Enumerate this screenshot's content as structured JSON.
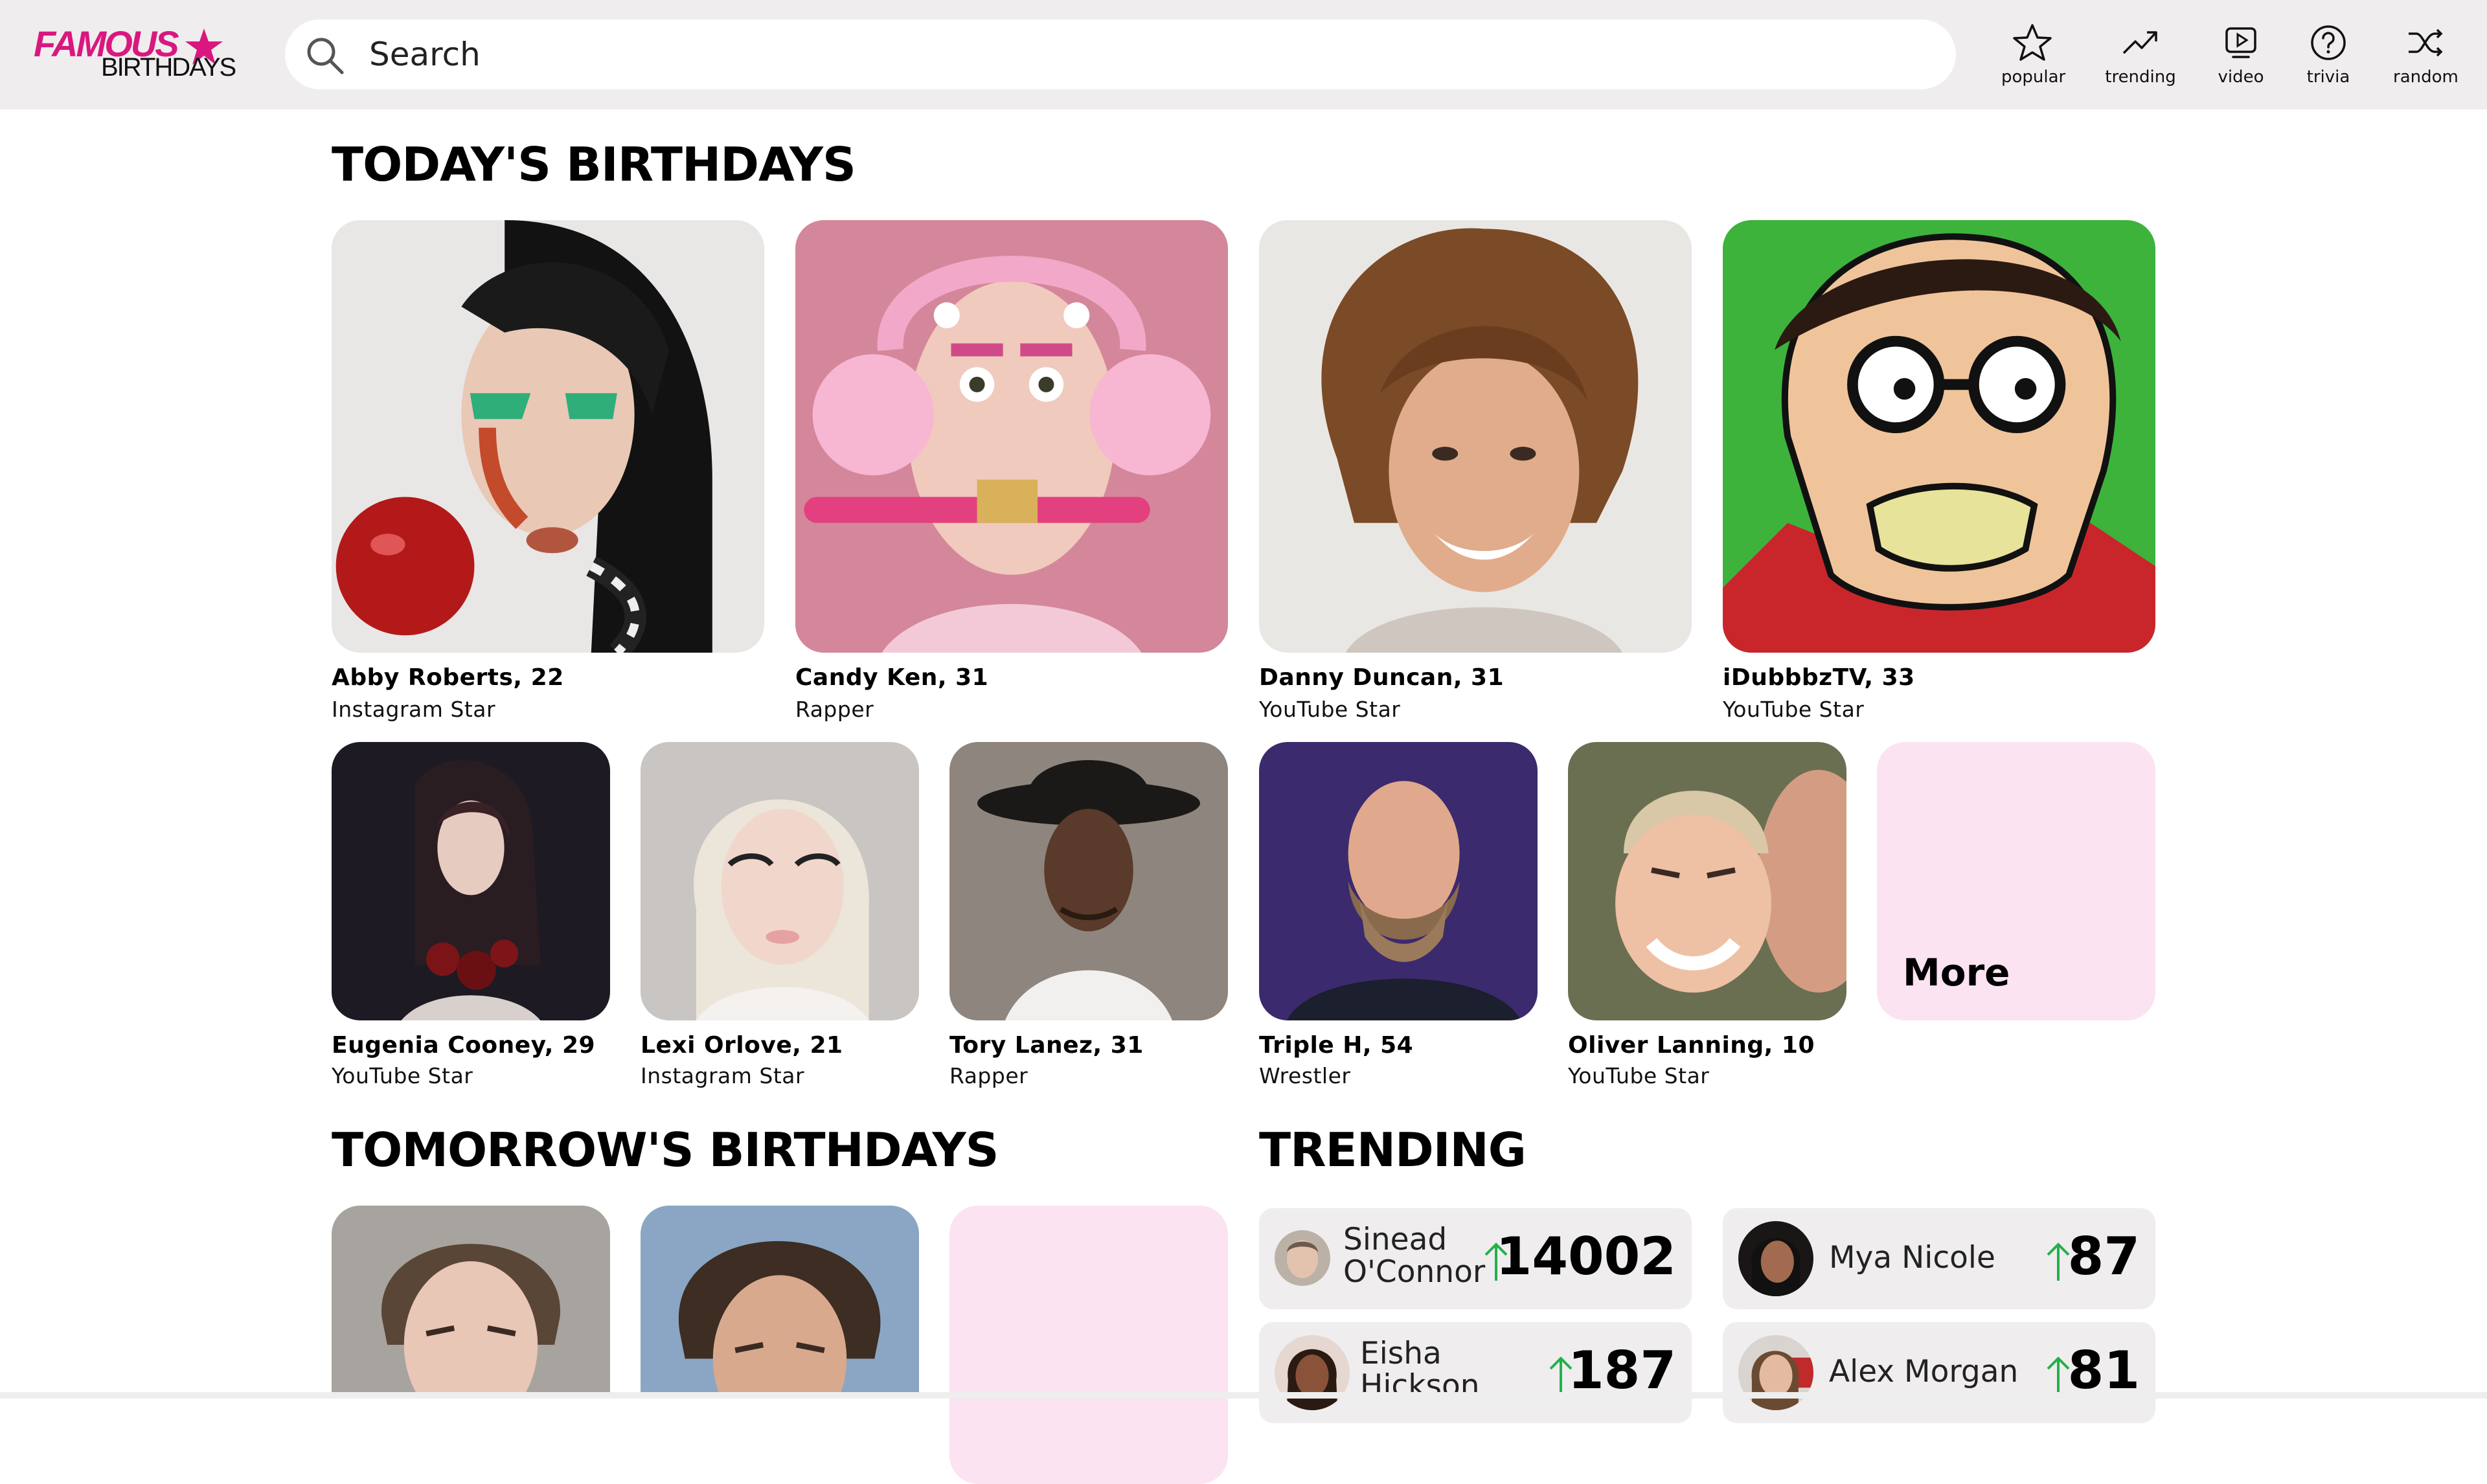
{
  "header": {
    "logo_top": "FAMOUS",
    "logo_bottom": "BIRTHDAYS",
    "search_placeholder": "Search",
    "nav": [
      {
        "label": "popular",
        "icon": "star-icon"
      },
      {
        "label": "trending",
        "icon": "trending-icon"
      },
      {
        "label": "video",
        "icon": "video-icon"
      },
      {
        "label": "trivia",
        "icon": "question-icon"
      },
      {
        "label": "random",
        "icon": "shuffle-icon"
      }
    ]
  },
  "today": {
    "title": "TODAY'S BIRTHDAYS",
    "large": [
      {
        "name": "Abby Roberts, 22",
        "job": "Instagram Star"
      },
      {
        "name": "Candy Ken, 31",
        "job": "Rapper"
      },
      {
        "name": "Danny Duncan, 31",
        "job": "YouTube Star"
      },
      {
        "name": "iDubbbzTV, 33",
        "job": "YouTube Star"
      }
    ],
    "small": [
      {
        "name": "Eugenia Cooney, 29",
        "job": "YouTube Star"
      },
      {
        "name": "Lexi Orlove, 21",
        "job": "Instagram Star"
      },
      {
        "name": "Tory Lanez, 31",
        "job": "Rapper"
      },
      {
        "name": "Triple H, 54",
        "job": "Wrestler"
      },
      {
        "name": "Oliver Lanning, 10",
        "job": "YouTube Star"
      }
    ],
    "more_label": "More"
  },
  "tomorrow": {
    "title": "TOMORROW'S BIRTHDAYS"
  },
  "trending": {
    "title": "TRENDING",
    "items": [
      {
        "name_line1": "Sinead",
        "name_line2": "O'Connor",
        "value": "14002"
      },
      {
        "name_line1": "Mya Nicole",
        "name_line2": "",
        "value": "87"
      },
      {
        "name_line1": "Eisha",
        "name_line2": "Hickson",
        "value": "187"
      },
      {
        "name_line1": "Alex Morgan",
        "name_line2": "",
        "value": "81"
      }
    ]
  },
  "colors": {
    "brand_pink": "#d9187f",
    "header_bg": "#efedee",
    "more_tile_bg": "#fbe3f1",
    "trend_arrow": "#22b14c"
  }
}
